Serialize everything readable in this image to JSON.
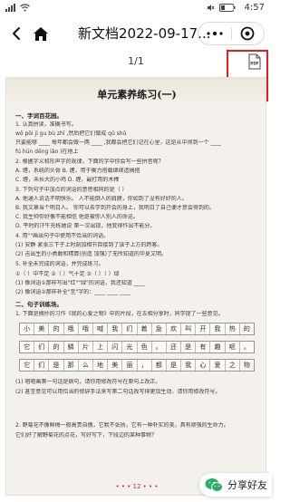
{
  "status_bar": {
    "battery": "26",
    "time": "4:57"
  },
  "nav": {
    "title": "新文档2022-09-17..."
  },
  "subbar": {
    "page_indicator": "1/1",
    "pdf_label": "PDF"
  },
  "document": {
    "title": "单元素养练习(一)",
    "lines": [
      "一、字词百花园。",
      "1. 认真拼读，准确书写。",
      "   wǒ pǒi      jì gu bù zhī     ,然后把它们做成 qǔ shǔ",
      "   只要能够 ____ 每年都会做一两 ____ ,我都会把它们记在心里，这是从中得到一个 ____",
      "   fú hūn dēng       lǎo     )在地上",
      "2. 根据字义和形声字的规律，下面的字中你会写一些拼音呢？",
      "   A. 缠，系统的头骨        B. 缠，用于衡力搭载继续造搞搭",
      "   C. 缠，未长大的小鸡       D. 缠，最打用的木棒",
      "3. 下列句子中加点的词语的意思相同的是（  ）",
      "   A. 他通人说话不明快乐。    人不能倒人的肩膀，你如到了没有好好的人。",
      "   B. 我文章当个明日人。      你可以去学到开会的身上，我明日了自己便才意会得到的。",
      "   C. 我生帅你好像不能相信    他是被你人别人的命运。",
      "   D. 平时的汗牛充栋她说      第一次出现，他变得作出不能分。",
      "4. 用\"\"画出句子中使用不恰当的词语。",
      "   (1) 安静  紧张三下子上时刻加相节目接到了该子上方的跨客。",
      "   (2) 吉出生的小勇敢和精算(创造 加强)了无所知道的华夏文明。",
      "5. 补全未完成的词语，并完成练习。",
      "   ①（   ）中不足   ②（   ）气十足   ③（   ）（   ）绿",
      "   (1) 像词语①那样写出\"红\"\"绿\"的词语，我还知道 ____",
      "   (2) 像词语②那样补全\"至\"字的：____  ____  ____",
      "二、句子训练场。",
      "1. 下面是摘抄的习作《我的心爱之物》中的片段，在五相分享时，同学提了一些意见。"
    ],
    "grid_rows": [
      [
        "小",
        "美",
        "的",
        "哦",
        "哦",
        "喊",
        "我",
        "们",
        "着",
        "急",
        "欢",
        "叫",
        "开",
        "我",
        "热",
        "的"
      ],
      [
        "它",
        "们",
        "的",
        "鳞",
        "片",
        "上",
        "闪",
        "光",
        "色",
        "。",
        "还",
        "是",
        "有",
        "趣",
        "呢",
        "。"
      ],
      [
        "它",
        "们",
        "是",
        "那",
        "么",
        "地",
        "美",
        "丽",
        "，",
        "都",
        "是",
        "我",
        "心",
        "爱",
        "之",
        "物"
      ]
    ],
    "lines_after": [
      "(1) 唱唱画第一句话是病句，请你用修改符号在原句上改正。",
      "(2) 甚至意见可以用恰当的修辞手法来写第二句话改写得更加生动，请你用修改符号。",
      "",
      "2. 野菊花不像鲜梅一般高贵自傲，它默不张扬，它有一种朴实的美，具有顽强的生命力。",
      "   它们好了解野菊花的点花，写好写下，下段边的某种事物？"
    ],
    "footer": "• • • 12 • • •"
  },
  "share": {
    "label": "分享好友"
  }
}
